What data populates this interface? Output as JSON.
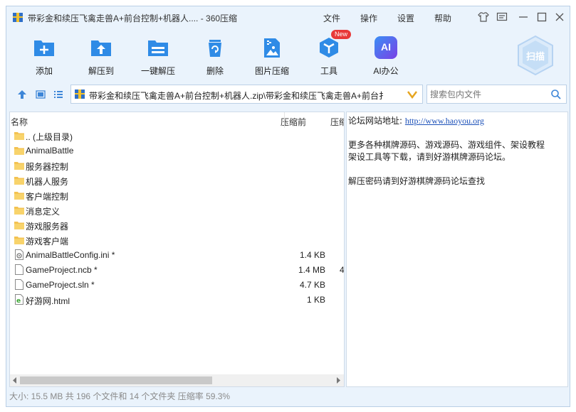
{
  "window": {
    "title": "带彩金和续压飞禽走兽A+前台控制+机器人.... - 360压缩",
    "menu": [
      "文件",
      "操作",
      "设置",
      "帮助"
    ]
  },
  "toolbar": {
    "items": [
      {
        "label": "添加",
        "icon": "add-icon",
        "color": "#2f8be6"
      },
      {
        "label": "解压到",
        "icon": "extract-to-icon",
        "color": "#2f8be6"
      },
      {
        "label": "一键解压",
        "icon": "one-click-extract-icon",
        "color": "#2f8be6"
      },
      {
        "label": "删除",
        "icon": "delete-icon",
        "color": "#2f8be6"
      },
      {
        "label": "图片压缩",
        "icon": "image-compress-icon",
        "color": "#2f8be6"
      },
      {
        "label": "工具",
        "icon": "tools-icon",
        "color": "#2f8be6"
      },
      {
        "label": "AI办公",
        "icon": "ai-office-icon",
        "color": "#3b7df0"
      }
    ],
    "new_badge": "New",
    "ai_glyph": "AI",
    "scan_label": "扫描"
  },
  "address": {
    "path": "带彩金和续压飞禽走兽A+前台控制+机器人.zip\\带彩金和续压飞禽走兽A+前台扌"
  },
  "search": {
    "placeholder": "搜索包内文件"
  },
  "file_list": {
    "headers": {
      "name": "名称",
      "before": "压缩前",
      "after": "压缩"
    },
    "rows": [
      {
        "name": ".. (上级目录)",
        "type": "folder",
        "size": "",
        "extra": ""
      },
      {
        "name": "AnimalBattle",
        "type": "folder",
        "size": "",
        "extra": ""
      },
      {
        "name": "服务器控制",
        "type": "folder",
        "size": "",
        "extra": ""
      },
      {
        "name": "机器人服务",
        "type": "folder",
        "size": "",
        "extra": ""
      },
      {
        "name": "客户端控制",
        "type": "folder",
        "size": "",
        "extra": ""
      },
      {
        "name": "消息定义",
        "type": "folder",
        "size": "",
        "extra": ""
      },
      {
        "name": "游戏服务器",
        "type": "folder",
        "size": "",
        "extra": ""
      },
      {
        "name": "游戏客户端",
        "type": "folder",
        "size": "",
        "extra": ""
      },
      {
        "name": "AnimalBattleConfig.ini *",
        "type": "ini",
        "size": "1.4 KB",
        "extra": ""
      },
      {
        "name": "GameProject.ncb *",
        "type": "file",
        "size": "1.4 MB",
        "extra": "4"
      },
      {
        "name": "GameProject.sln *",
        "type": "file",
        "size": "4.7 KB",
        "extra": ""
      },
      {
        "name": "好游网.html",
        "type": "html",
        "size": "1 KB",
        "extra": ""
      }
    ]
  },
  "info": {
    "forum_label": "论坛网站地址:",
    "forum_url": "http://www.haoyou.org",
    "line2": "更多各种棋牌源码、游戏源码、游戏组件、架设教程",
    "line3": "架设工具等下载，请到好游棋牌源码论坛。",
    "line4": "解压密码请到好游棋牌源码论坛查找"
  },
  "status": "大小: 15.5 MB 共 196 个文件和 14 个文件夹 压缩率 59.3%"
}
